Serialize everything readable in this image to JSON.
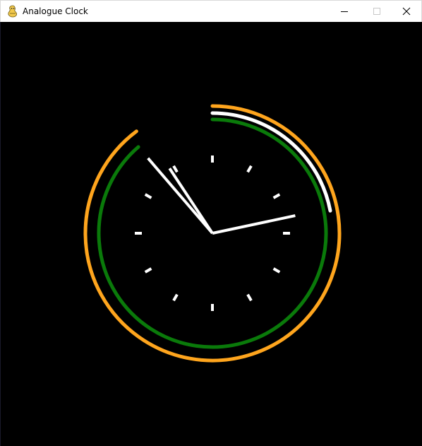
{
  "window": {
    "title": "Analogue Clock",
    "icon": "pygame-snake-icon",
    "controls": {
      "minimize_icon": "minimize-icon",
      "maximize_icon": "maximize-icon",
      "close_icon": "close-icon"
    }
  },
  "clock": {
    "time_shown": {
      "hour": 10,
      "minute": 53,
      "second": 13
    },
    "hand_color": "#ffffff",
    "tick_color": "#ffffff",
    "background_color": "#000000",
    "arcs": {
      "hours": {
        "color": "#ffa51d",
        "fraction": 0.898
      },
      "minutes": {
        "color": "#0a7a0a",
        "fraction": 0.887
      },
      "seconds": {
        "color": "#ffffff",
        "fraction": 0.22
      }
    }
  }
}
